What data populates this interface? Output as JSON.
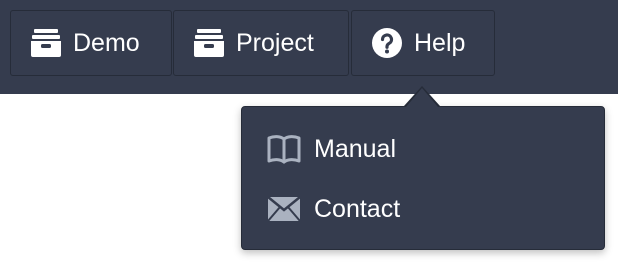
{
  "topbar": {
    "buttons": [
      {
        "label": "Demo",
        "icon": "archive-box-icon"
      },
      {
        "label": "Project",
        "icon": "archive-box-icon"
      },
      {
        "label": "Help",
        "icon": "question-circle-icon"
      }
    ]
  },
  "help_menu": {
    "items": [
      {
        "label": "Manual",
        "icon": "book-icon"
      },
      {
        "label": "Contact",
        "icon": "envelope-icon"
      }
    ]
  },
  "colors": {
    "bar_bg": "#353c4e",
    "text": "#ffffff",
    "menu_icon": "#aab2c0"
  }
}
